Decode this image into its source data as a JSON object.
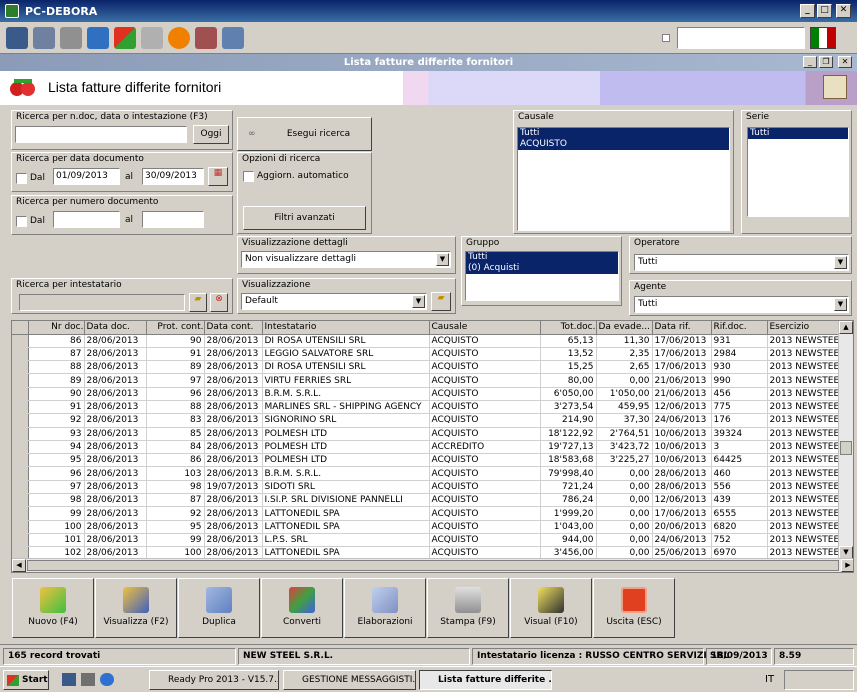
{
  "window": {
    "title": "PC-DEBORA"
  },
  "toolbar": {
    "icons": [
      "monitor-icon",
      "windows-icon",
      "tools-icon",
      "refresh-icon",
      "windows-logo-icon",
      "drive-icon",
      "alert-icon",
      "disconnect-icon",
      "fullscreen-icon"
    ]
  },
  "inner_window": {
    "title": "Lista fatture differite fornitori"
  },
  "header": {
    "title": "Lista fatture differite fornitori"
  },
  "search_ndoc": {
    "label": "Ricerca per n.doc, data o intestazione (F3)",
    "value": "",
    "today_button": "Oggi"
  },
  "search_date": {
    "label": "Ricerca per data documento",
    "from_label": "Dal",
    "from": "01/09/2013",
    "to_label": "al",
    "to": "30/09/2013"
  },
  "search_number": {
    "label": "Ricerca per numero documento",
    "from_label": "Dal",
    "from": "",
    "to_label": "al",
    "to": ""
  },
  "search_holder": {
    "label": "Ricerca per intestatario",
    "value": ""
  },
  "execute_button": "Esegui ricerca",
  "options": {
    "label": "Opzioni di ricerca",
    "auto_update": "Aggiorn. automatico",
    "advanced_filters": "Filtri avanzati"
  },
  "details_view": {
    "label": "Visualizzazione dettagli",
    "value": "Non visualizzare dettagli"
  },
  "view": {
    "label": "Visualizzazione",
    "value": "Default"
  },
  "causale": {
    "label": "Causale",
    "items": [
      "Tutti",
      "ACQUISTO"
    ]
  },
  "serie": {
    "label": "Serie",
    "items": [
      "Tutti"
    ]
  },
  "gruppo": {
    "label": "Gruppo",
    "items": [
      "Tutti",
      "(0) Acquisti"
    ]
  },
  "operatore": {
    "label": "Operatore",
    "value": "Tutti"
  },
  "agente": {
    "label": "Agente",
    "value": "Tutti"
  },
  "grid": {
    "columns": [
      "Nr doc.",
      "Data doc.",
      "Prot. cont.",
      "Data cont.",
      "Intestatario",
      "Causale",
      "Tot.doc.",
      "Da evade...",
      "Data rif.",
      "Rif.doc.",
      "Esercizio"
    ],
    "rows": [
      [
        "86",
        "28/06/2013",
        "90",
        "28/06/2013",
        "DI ROSA UTENSILI SRL",
        "ACQUISTO",
        "65,13",
        "11,30",
        "17/06/2013",
        "931",
        "2013 NEWSTEEL"
      ],
      [
        "87",
        "28/06/2013",
        "91",
        "28/06/2013",
        "LEGGIO SALVATORE SRL",
        "ACQUISTO",
        "13,52",
        "2,35",
        "17/06/2013",
        "2984",
        "2013 NEWSTEEL"
      ],
      [
        "88",
        "28/06/2013",
        "89",
        "28/06/2013",
        "DI ROSA UTENSILI SRL",
        "ACQUISTO",
        "15,25",
        "2,65",
        "17/06/2013",
        "930",
        "2013 NEWSTEEL"
      ],
      [
        "89",
        "28/06/2013",
        "97",
        "28/06/2013",
        "VIRTU FERRIES SRL",
        "ACQUISTO",
        "80,00",
        "0,00",
        "21/06/2013",
        "990",
        "2013 NEWSTEEL"
      ],
      [
        "90",
        "28/06/2013",
        "96",
        "28/06/2013",
        "B.R.M. S.R.L.",
        "ACQUISTO",
        "6'050,00",
        "1'050,00",
        "21/06/2013",
        "456",
        "2013 NEWSTEEL"
      ],
      [
        "91",
        "28/06/2013",
        "88",
        "28/06/2013",
        "MARLINES SRL - SHIPPING AGENCY",
        "ACQUISTO",
        "3'273,54",
        "459,95",
        "12/06/2013",
        "775",
        "2013 NEWSTEEL"
      ],
      [
        "92",
        "28/06/2013",
        "83",
        "28/06/2013",
        "SIGNORINO SRL",
        "ACQUISTO",
        "214,90",
        "37,30",
        "24/06/2013",
        "176",
        "2013 NEWSTEEL"
      ],
      [
        "93",
        "28/06/2013",
        "85",
        "28/06/2013",
        "POLMESH LTD",
        "ACQUISTO",
        "18'122,92",
        "2'764,51",
        "10/06/2013",
        "39324",
        "2013 NEWSTEEL"
      ],
      [
        "94",
        "28/06/2013",
        "84",
        "28/06/2013",
        "POLMESH LTD",
        "ACCREDITO",
        "19'727,13",
        "3'423,72",
        "10/06/2013",
        "3",
        "2013 NEWSTEEL"
      ],
      [
        "95",
        "28/06/2013",
        "86",
        "28/06/2013",
        "POLMESH LTD",
        "ACQUISTO",
        "18'583,68",
        "3'225,27",
        "10/06/2013",
        "64425",
        "2013 NEWSTEEL"
      ],
      [
        "96",
        "28/06/2013",
        "103",
        "28/06/2013",
        "B.R.M. S.R.L.",
        "ACQUISTO",
        "79'998,40",
        "0,00",
        "28/06/2013",
        "460",
        "2013 NEWSTEEL"
      ],
      [
        "97",
        "28/06/2013",
        "98",
        "19/07/2013",
        "SIDOTI SRL",
        "ACQUISTO",
        "721,24",
        "0,00",
        "28/06/2013",
        "556",
        "2013 NEWSTEEL"
      ],
      [
        "98",
        "28/06/2013",
        "87",
        "28/06/2013",
        "I.SI.P. SRL DIVISIONE PANNELLI",
        "ACQUISTO",
        "786,24",
        "0,00",
        "12/06/2013",
        "439",
        "2013 NEWSTEEL"
      ],
      [
        "99",
        "28/06/2013",
        "92",
        "28/06/2013",
        "LATTONEDIL SPA",
        "ACQUISTO",
        "1'999,20",
        "0,00",
        "17/06/2013",
        "6555",
        "2013 NEWSTEEL"
      ],
      [
        "100",
        "28/06/2013",
        "95",
        "28/06/2013",
        "LATTONEDIL SPA",
        "ACQUISTO",
        "1'043,00",
        "0,00",
        "20/06/2013",
        "6820",
        "2013 NEWSTEEL"
      ],
      [
        "101",
        "28/06/2013",
        "99",
        "28/06/2013",
        "L.P.S. SRL",
        "ACQUISTO",
        "944,00",
        "0,00",
        "24/06/2013",
        "752",
        "2013 NEWSTEEL"
      ],
      [
        "102",
        "28/06/2013",
        "100",
        "28/06/2013",
        "LATTONEDIL SPA",
        "ACQUISTO",
        "3'456,00",
        "0,00",
        "25/06/2013",
        "6970",
        "2013 NEWSTEEL"
      ]
    ]
  },
  "actions": [
    "Nuovo (F4)",
    "Visualizza (F2)",
    "Duplica",
    "Converti",
    "Elaborazioni",
    "Stampa (F9)",
    "Visual (F10)",
    "Uscita (ESC)"
  ],
  "status": {
    "records": "165 record trovati",
    "company": "NEW STEEL S.R.L.",
    "license": "Intestatario licenza : RUSSO CENTRO SERVIZI SRL",
    "date": "18/09/2013",
    "version": "8.59"
  },
  "taskbar": {
    "start": "Start",
    "tasks": [
      "Ready Pro 2013 - V15.7....",
      "GESTIONE MESSAGGISTI...",
      "Lista fatture differite ..."
    ],
    "lang": "IT"
  },
  "colors": {
    "title_bar": "#0a246a",
    "selection": "#0a246a",
    "background": "#d4d0c8"
  }
}
